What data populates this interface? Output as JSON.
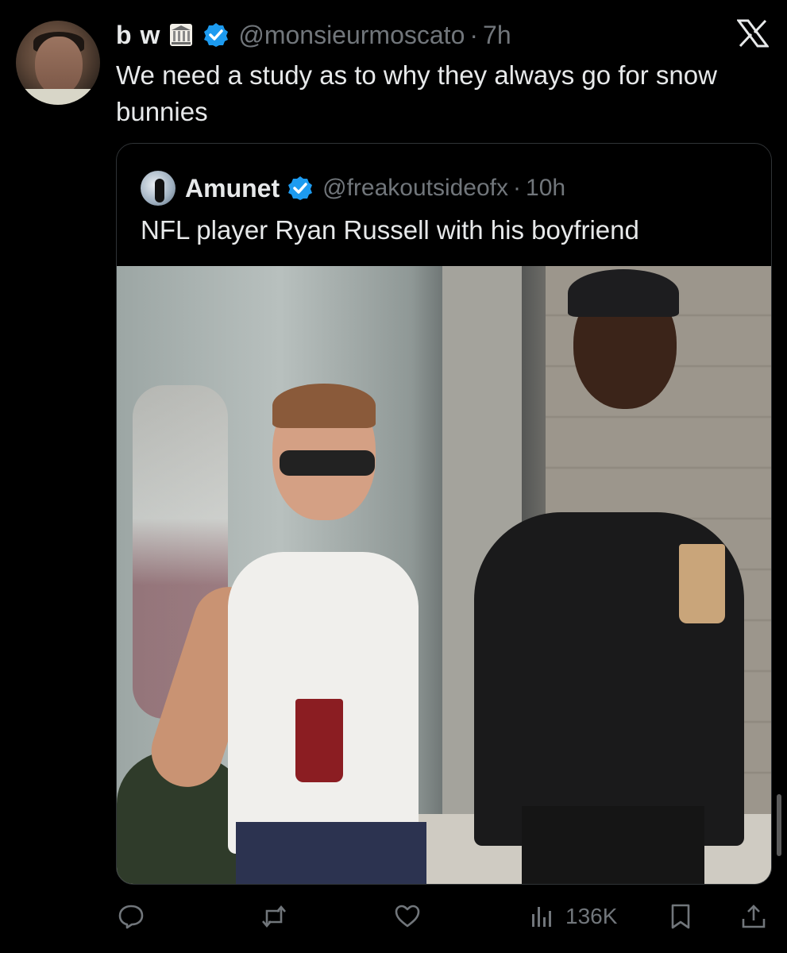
{
  "tweet": {
    "author": {
      "name": "b w",
      "handle": "@monsieurmoscato",
      "time": "7h",
      "badge_icon": "bank-icon",
      "verified": true
    },
    "separator": "·",
    "text": "We need a study as to why they always go for snow bunnies"
  },
  "quoted_tweet": {
    "author": {
      "name": "Amunet",
      "handle": "@freakoutsideofx",
      "time": "10h",
      "verified": true
    },
    "separator": "·",
    "text": "NFL player Ryan Russell with his boyfriend"
  },
  "actions": {
    "views": "136K"
  },
  "colors": {
    "background": "#000000",
    "text": "#e7e9ea",
    "muted": "#71767b",
    "verified_blue": "#1d9bf0",
    "border": "#2f3336"
  }
}
